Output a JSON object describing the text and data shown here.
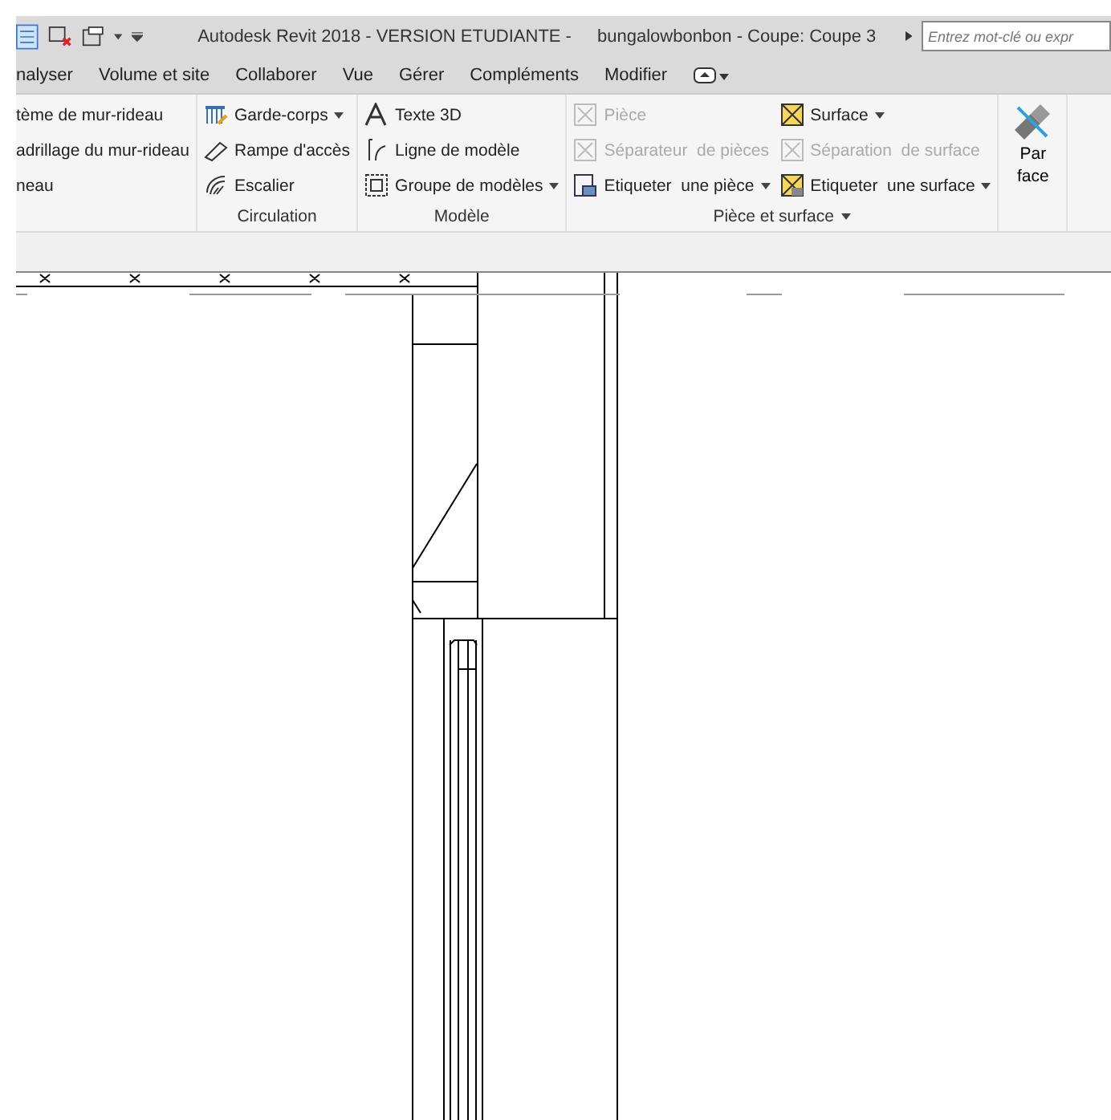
{
  "title_bar": {
    "title": "Autodesk Revit 2018 - VERSION ETUDIANTE -",
    "document": "bungalowbonbon - Coupe: Coupe 3",
    "search": {
      "placeholder": "Entrez mot-clé ou expr"
    }
  },
  "tabs": [
    {
      "label": "nalyser"
    },
    {
      "label": "Volume et site"
    },
    {
      "label": "Collaborer"
    },
    {
      "label": "Vue"
    },
    {
      "label": "Gérer"
    },
    {
      "label": "Compléments"
    },
    {
      "label": "Modifier"
    }
  ],
  "ribbon": {
    "panels": [
      {
        "columns": [
          [
            {
              "label": "tème de mur-rideau",
              "kind": "plain",
              "disabled": false,
              "dropdown": false
            },
            {
              "label": "adrillage du mur-rideau",
              "kind": "plain",
              "disabled": false,
              "dropdown": false
            },
            {
              "label": "neau",
              "kind": "plain",
              "disabled": false,
              "dropdown": false
            }
          ]
        ]
      },
      {
        "title": "Circulation",
        "title_dropdown": false,
        "columns": [
          [
            {
              "label": "Garde-corps",
              "kind": "railing",
              "disabled": false,
              "dropdown": true
            },
            {
              "label": "Rampe d'accès",
              "kind": "ramp",
              "disabled": false,
              "dropdown": false
            },
            {
              "label": "Escalier",
              "kind": "stair",
              "disabled": false,
              "dropdown": false
            }
          ]
        ]
      },
      {
        "title": "Modèle",
        "title_dropdown": false,
        "columns": [
          [
            {
              "label": "Texte 3D",
              "kind": "text3d",
              "disabled": false,
              "dropdown": false
            },
            {
              "label": "Ligne de modèle",
              "kind": "line",
              "disabled": false,
              "dropdown": false
            },
            {
              "label": "Groupe de modèles",
              "kind": "group",
              "disabled": false,
              "dropdown": true
            }
          ]
        ]
      },
      {
        "title": "Pièce et surface",
        "title_dropdown": true,
        "columns": [
          [
            {
              "label": "Pièce",
              "kind": "room",
              "disabled": true,
              "dropdown": false
            },
            {
              "label": "Séparateur  de pièces",
              "kind": "separator",
              "disabled": true,
              "dropdown": false
            },
            {
              "label": "Etiqueter  une pièce",
              "kind": "tag",
              "disabled": false,
              "dropdown": true
            }
          ],
          [
            {
              "label": "Surface",
              "kind": "area",
              "disabled": false,
              "dropdown": true
            },
            {
              "label": "Séparation  de surface",
              "kind": "separator",
              "disabled": true,
              "dropdown": false
            },
            {
              "label": "Etiqueter  une surface",
              "kind": "areatag",
              "disabled": false,
              "dropdown": true
            }
          ]
        ]
      }
    ],
    "large_button": {
      "label": "Par face"
    }
  }
}
